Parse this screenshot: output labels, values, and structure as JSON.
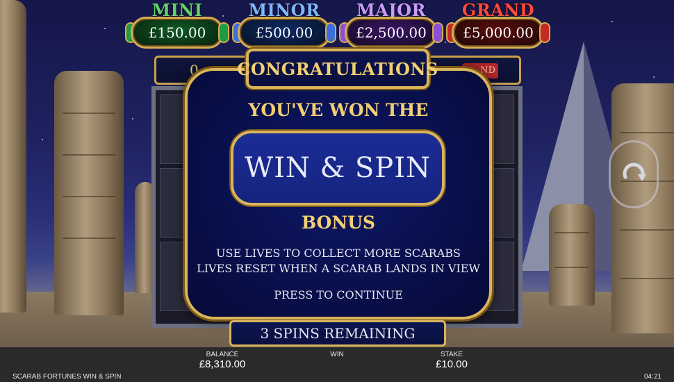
{
  "jackpots": [
    {
      "name": "MINI",
      "value": "£150.00",
      "name_color": "#63d06a",
      "plate_color": "#0f5a23",
      "gem_color": "#1f9a45"
    },
    {
      "name": "MINOR",
      "value": "£500.00",
      "name_color": "#7fb6ff",
      "plate_color": "#0d2a66",
      "gem_color": "#3c6fd8"
    },
    {
      "name": "MAJOR",
      "value": "£2,500.00",
      "name_color": "#c99bff",
      "plate_color": "#3a1466",
      "gem_color": "#8d4fd6"
    },
    {
      "name": "GRAND",
      "value": "£5,000.00",
      "name_color": "#ff4a3a",
      "plate_color": "#5a0d0d",
      "gem_color": "#c42a22"
    }
  ],
  "topbar": {
    "left_text": "0",
    "right_tag": "ND"
  },
  "modal": {
    "header": "CONGRATULATIONS",
    "won_line": "YOU'VE WON THE",
    "feature": "WIN & SPIN",
    "bonus": "BONUS",
    "desc_line1": "USE LIVES TO COLLECT MORE SCARABS",
    "desc_line2": "LIVES RESET WHEN A SCARAB LANDS IN VIEW",
    "press": "PRESS TO CONTINUE"
  },
  "spins_remaining": "3 SPINS REMAINING",
  "footer": {
    "balance_label": "BALANCE",
    "balance_value": "£8,310.00",
    "win_label": "WIN",
    "win_value": "",
    "stake_label": "STAKE",
    "stake_value": "£10.00",
    "game_name": "SCARAB FORTUNES WIN & SPIN",
    "clock": "04:21"
  },
  "icons": {
    "spin": "spin-arrow-icon"
  },
  "colors": {
    "gold": "#d9b45b",
    "gold_text": "#f2cf72",
    "panel": "#09104d"
  }
}
